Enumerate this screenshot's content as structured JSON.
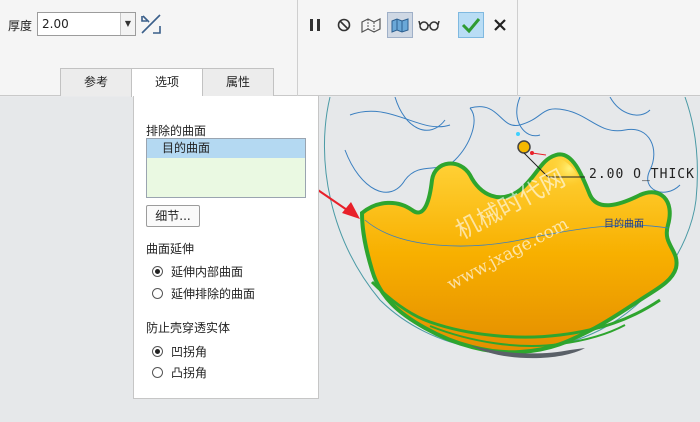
{
  "ribbon": {
    "thickness_label": "厚度",
    "thickness_value": "2.00",
    "tabs": [
      {
        "label": "参考",
        "active": false
      },
      {
        "label": "选项",
        "active": true
      },
      {
        "label": "属性",
        "active": false
      }
    ],
    "tools": [
      {
        "name": "pause-icon",
        "state": "normal"
      },
      {
        "name": "no-preview-icon",
        "state": "normal"
      },
      {
        "name": "preview-geometry-icon",
        "state": "normal"
      },
      {
        "name": "verify-icon",
        "state": "pressed"
      },
      {
        "name": "glasses-icon",
        "state": "normal"
      },
      {
        "name": "confirm-check-icon",
        "state": "accent"
      },
      {
        "name": "cancel-x-icon",
        "state": "normal"
      }
    ]
  },
  "options_panel": {
    "excluded_surfaces_label": "排除的曲面",
    "excluded_surfaces": [
      "目的曲面"
    ],
    "detail_button": "细节...",
    "surface_extend_label": "曲面延伸",
    "surface_extend_options": [
      {
        "label": "延伸内部曲面",
        "selected": true
      },
      {
        "label": "延伸排除的曲面",
        "selected": false
      }
    ],
    "prevent_label": "防止壳穿透实体",
    "prevent_options": [
      {
        "label": "凹拐角",
        "selected": true
      },
      {
        "label": "凸拐角",
        "selected": false
      }
    ]
  },
  "viewport": {
    "dimension_text": "2.00 O_THICK",
    "surface_label": "目的曲面",
    "watermark_cn": "机械时代网",
    "watermark_url": "www.jxage.com"
  },
  "colors": {
    "accent_blue": "#b9ddf5",
    "part_orange": "#f5a800",
    "edge_green": "#2ea52e",
    "arrow_red": "#e8202a",
    "wire_blue": "#3a7fc0"
  }
}
